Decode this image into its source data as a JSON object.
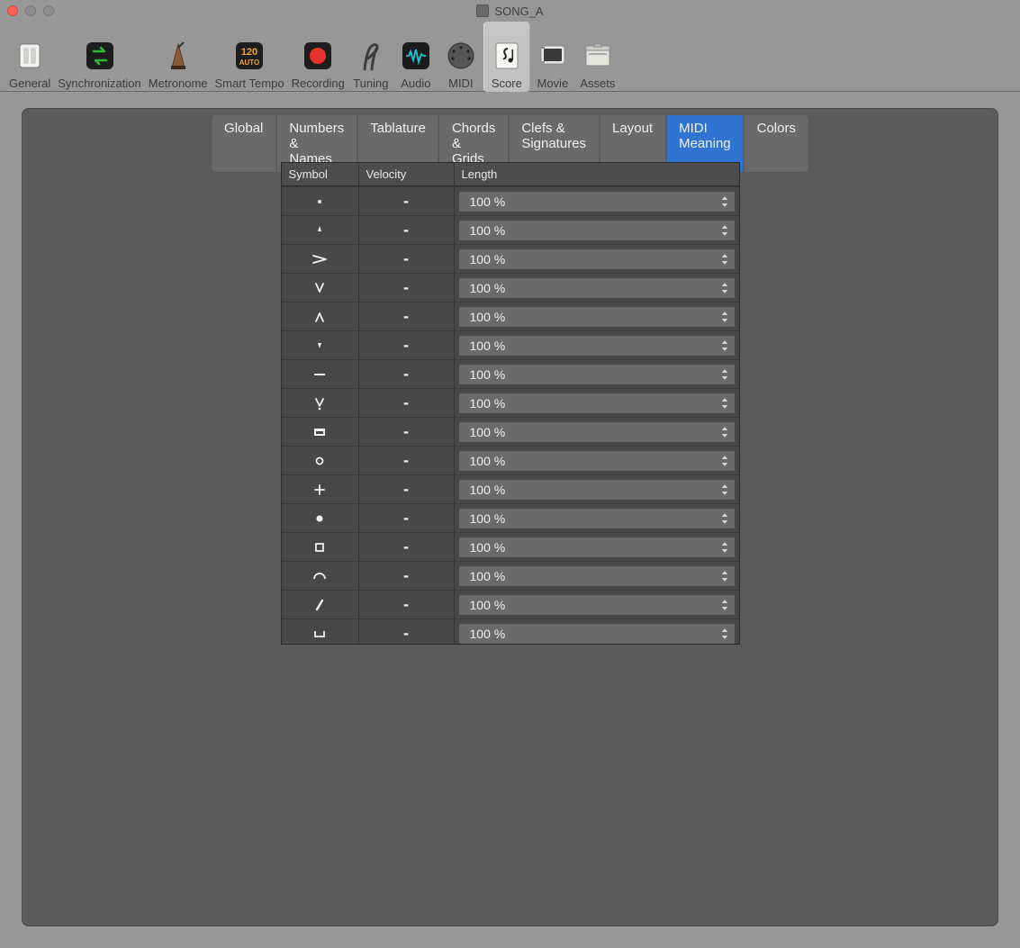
{
  "window": {
    "title": "SONG_A"
  },
  "toolbar": [
    {
      "key": "general",
      "label": "General"
    },
    {
      "key": "synchronization",
      "label": "Synchronization"
    },
    {
      "key": "metronome",
      "label": "Metronome"
    },
    {
      "key": "smarttempo",
      "label": "Smart Tempo"
    },
    {
      "key": "recording",
      "label": "Recording"
    },
    {
      "key": "tuning",
      "label": "Tuning"
    },
    {
      "key": "audio",
      "label": "Audio"
    },
    {
      "key": "midi",
      "label": "MIDI"
    },
    {
      "key": "score",
      "label": "Score",
      "selected": true
    },
    {
      "key": "movie",
      "label": "Movie"
    },
    {
      "key": "assets",
      "label": "Assets"
    }
  ],
  "subtabs": [
    {
      "label": "Global"
    },
    {
      "label": "Numbers & Names"
    },
    {
      "label": "Tablature"
    },
    {
      "label": "Chords & Grids"
    },
    {
      "label": "Clefs & Signatures"
    },
    {
      "label": "Layout"
    },
    {
      "label": "MIDI Meaning",
      "active": true
    },
    {
      "label": "Colors"
    }
  ],
  "table": {
    "headers": {
      "symbol": "Symbol",
      "velocity": "Velocity",
      "length": "Length"
    },
    "rows": [
      {
        "symbol": "staccato-dot",
        "velocity": "-",
        "length": "100 %"
      },
      {
        "symbol": "staccatissimo",
        "velocity": "-",
        "length": "100 %"
      },
      {
        "symbol": "accent",
        "velocity": "-",
        "length": "100 %"
      },
      {
        "symbol": "v-down",
        "velocity": "-",
        "length": "100 %"
      },
      {
        "symbol": "v-up",
        "velocity": "-",
        "length": "100 %"
      },
      {
        "symbol": "small-triangle-down",
        "velocity": "-",
        "length": "100 %"
      },
      {
        "symbol": "tenuto",
        "velocity": "-",
        "length": "100 %"
      },
      {
        "symbol": "v-dot",
        "velocity": "-",
        "length": "100 %"
      },
      {
        "symbol": "down-bow",
        "velocity": "-",
        "length": "100 %"
      },
      {
        "symbol": "open-circle",
        "velocity": "-",
        "length": "100 %"
      },
      {
        "symbol": "plus",
        "velocity": "-",
        "length": "100 %"
      },
      {
        "symbol": "filled-circle",
        "velocity": "-",
        "length": "100 %"
      },
      {
        "symbol": "square-outline",
        "velocity": "-",
        "length": "100 %"
      },
      {
        "symbol": "fermata-arc",
        "velocity": "-",
        "length": "100 %"
      },
      {
        "symbol": "slash",
        "velocity": "-",
        "length": "100 %"
      },
      {
        "symbol": "bracket-under",
        "velocity": "-",
        "length": "100 %"
      }
    ]
  }
}
